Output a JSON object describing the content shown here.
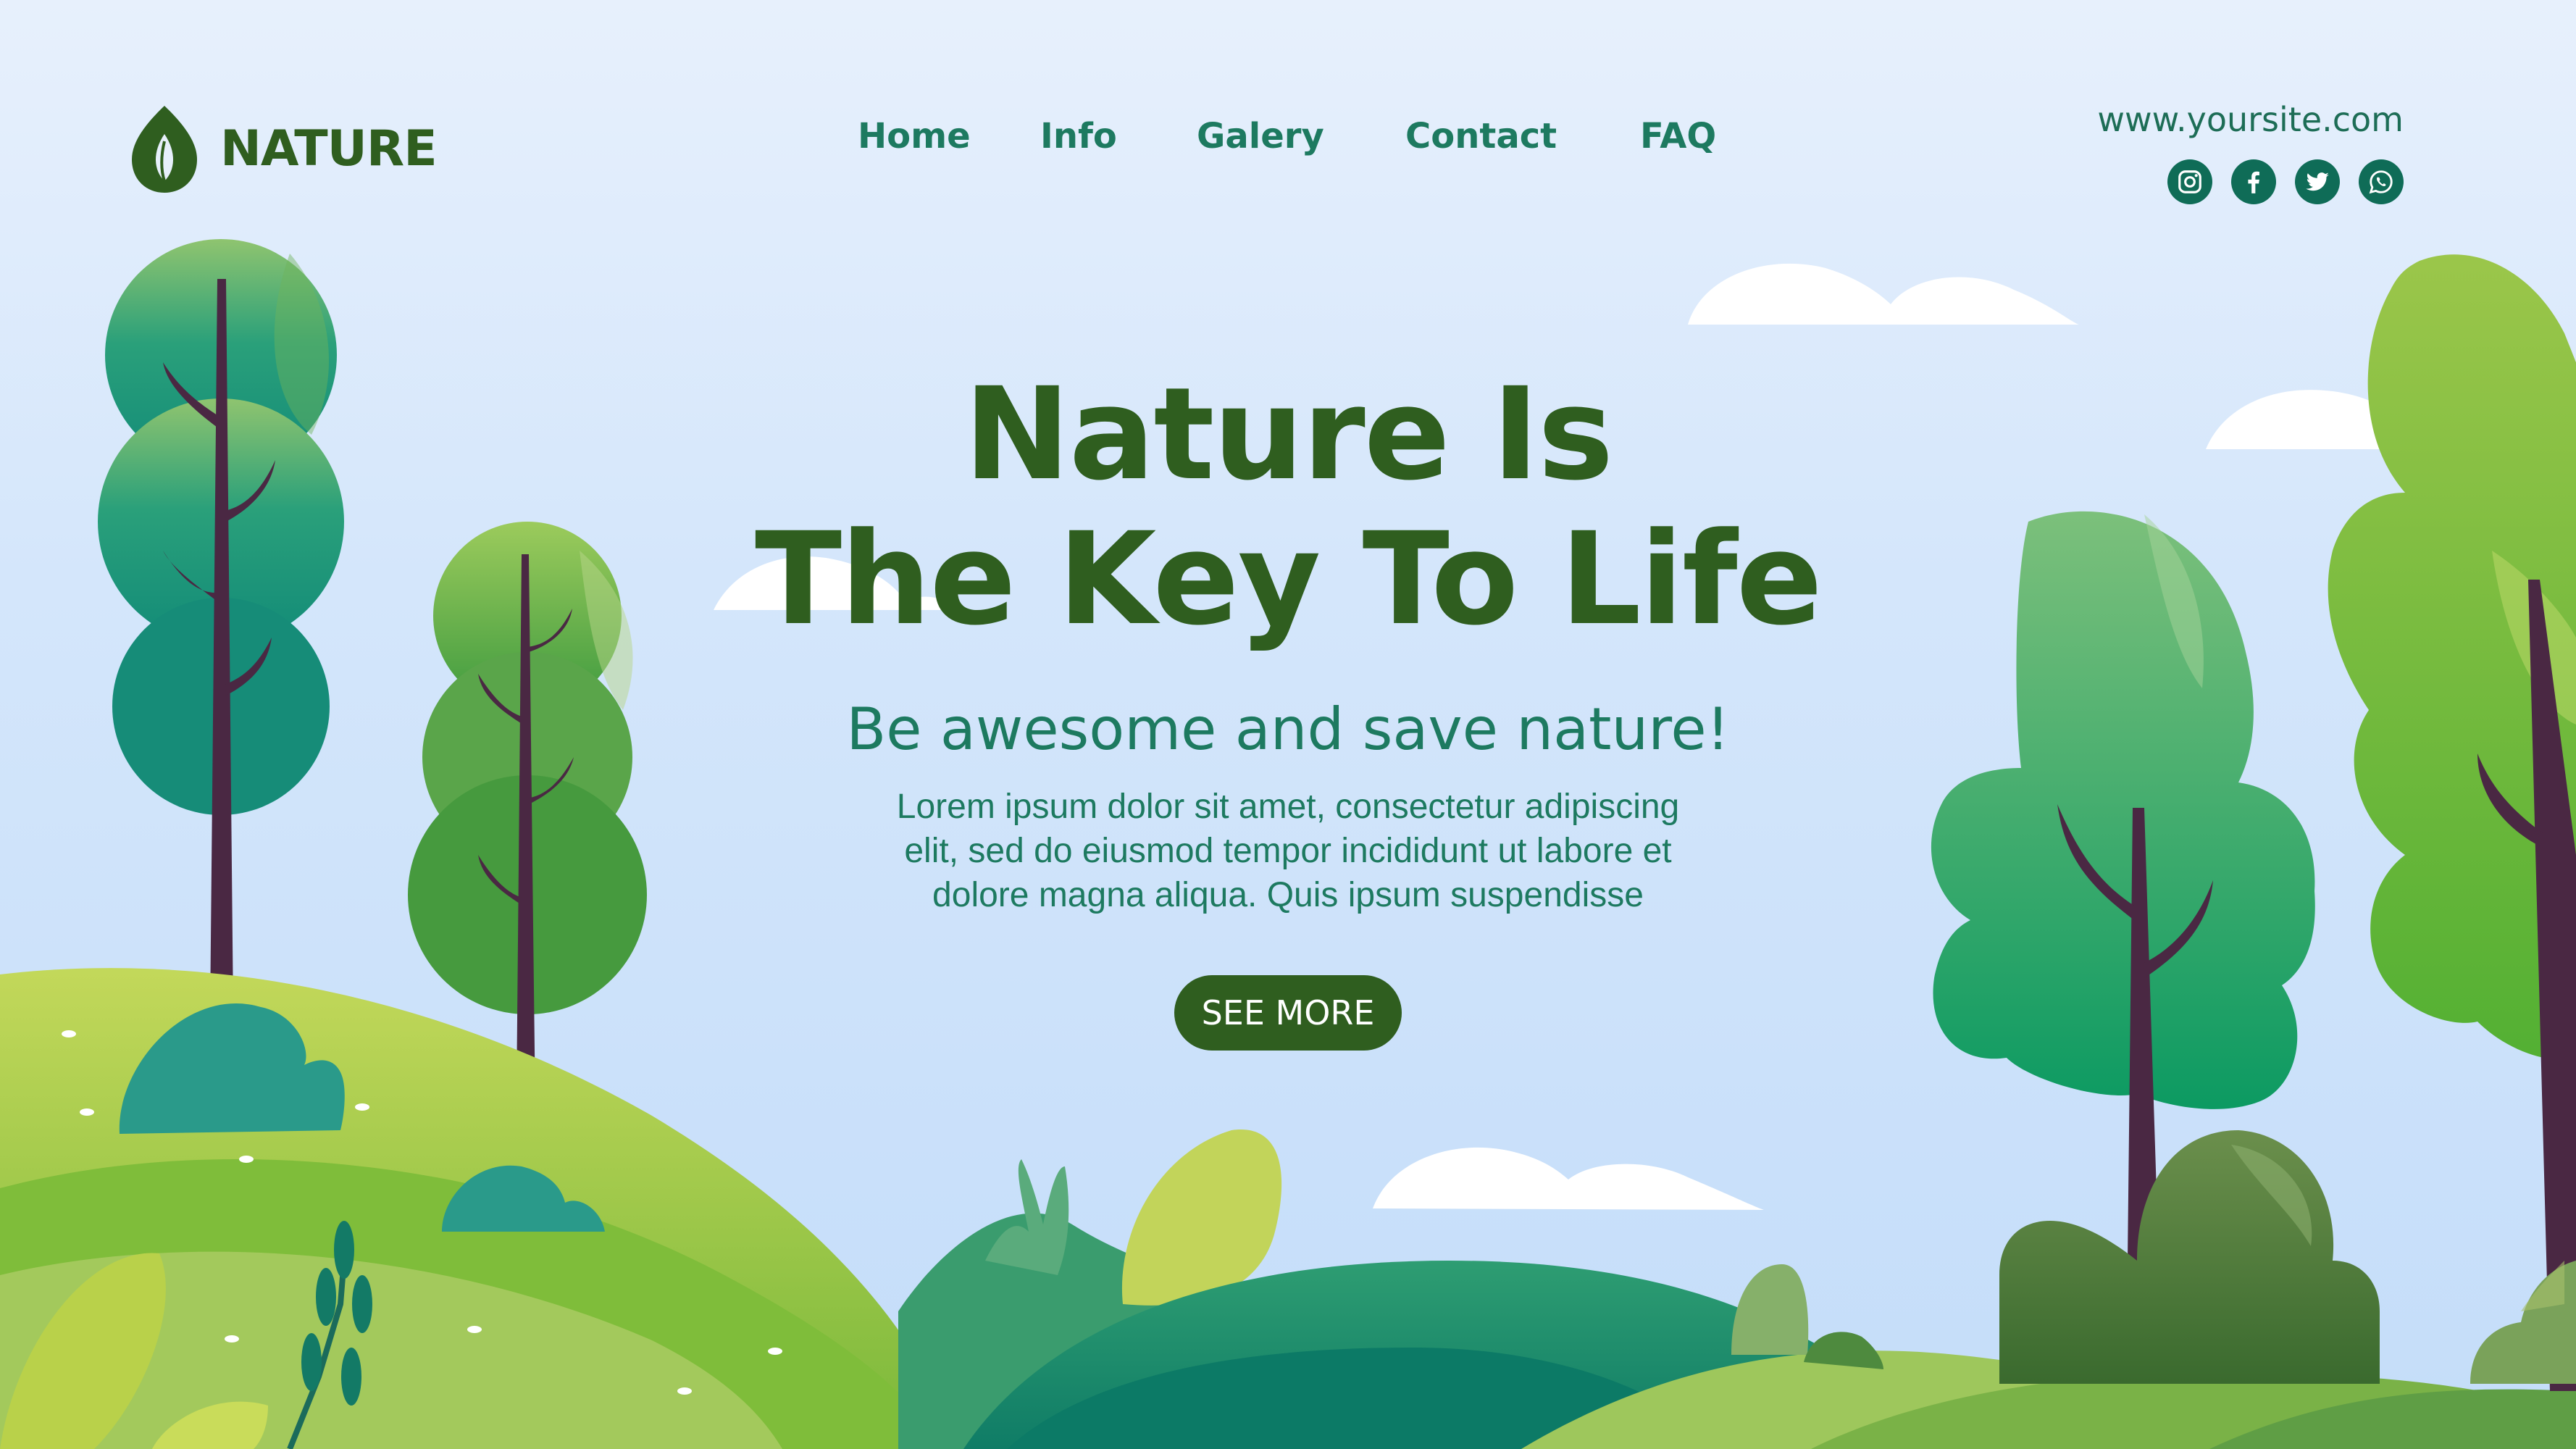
{
  "brand": {
    "name": "NATURE",
    "icon": "leaf-icon"
  },
  "nav": {
    "items": [
      "Home",
      "Info",
      "Galery",
      "Contact",
      "FAQ"
    ]
  },
  "contact": {
    "url": "www.yoursite.com",
    "socials": [
      "instagram-icon",
      "facebook-icon",
      "twitter-icon",
      "whatsapp-icon"
    ]
  },
  "hero": {
    "title_line1": "Nature Is",
    "title_line2": "The Key To Life",
    "subtitle": "Be awesome and save nature!",
    "body_lines": [
      "Lorem ipsum dolor sit amet, consectetur adipiscing",
      "elit, sed do eiusmod tempor incididunt ut labore et",
      "dolore magna aliqua. Quis ipsum suspendisse"
    ],
    "cta_label": "SEE MORE"
  },
  "colors": {
    "dark_green": "#2f5e1f",
    "teal": "#1d7a60",
    "sky": "#d4e6fb",
    "button": "#2f5e1f"
  }
}
